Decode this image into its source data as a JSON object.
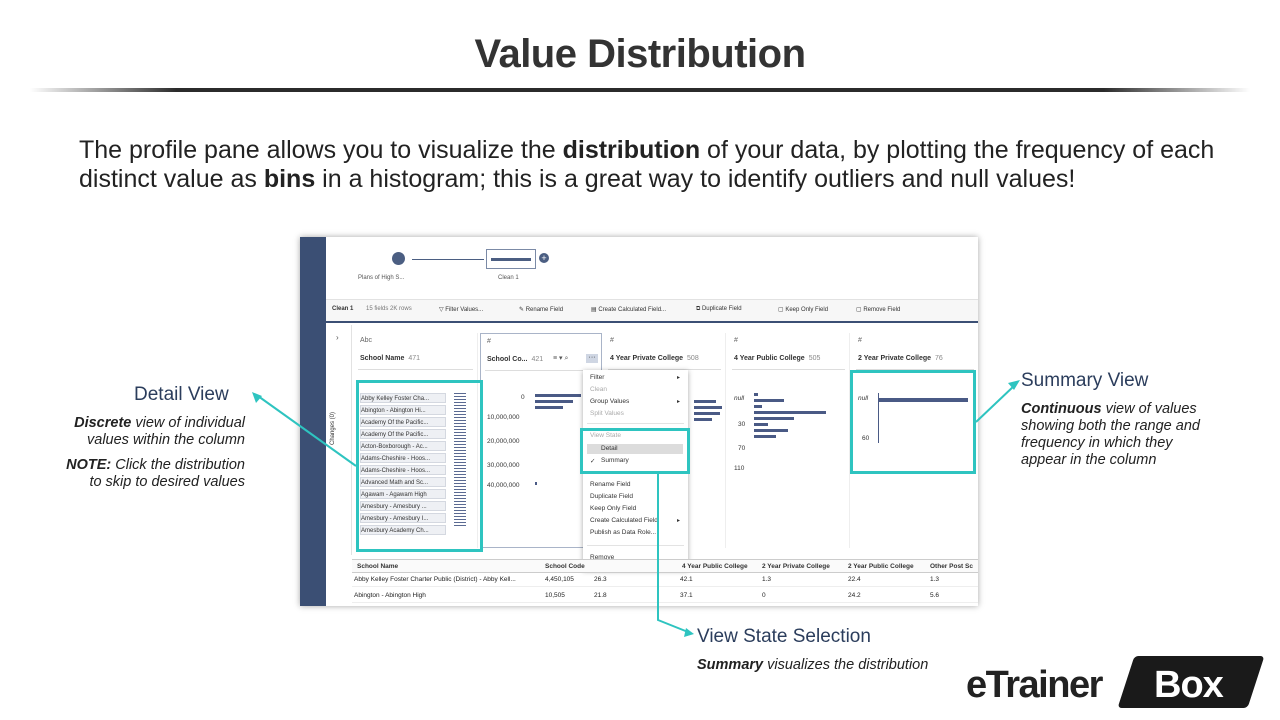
{
  "slide": {
    "title": "Value Distribution",
    "intro": {
      "p1": "The profile pane allows you to visualize the ",
      "b1": "distribution",
      "p2": " of your data, by plotting the frequency of each distinct value as ",
      "b2": "bins",
      "p3": " in a histogram; this is a great way to identify outliers and null values!"
    }
  },
  "flow": {
    "input_label": "Plans of High S...",
    "clean_label": "Clean 1",
    "plus": "+"
  },
  "toolbar": {
    "step": "Clean 1",
    "counts": "15 fields  2K rows",
    "filter": "Filter Values...",
    "rename": "Rename Field",
    "calc": "Create Calculated Field...",
    "duplicate": "Duplicate Field",
    "keep": "Keep Only Field",
    "remove": "Remove Field"
  },
  "changes": {
    "chevron": "›",
    "label": "Changes (0)"
  },
  "columns": [
    {
      "type": "Abc",
      "name": "School Name",
      "count": "471"
    },
    {
      "type": "#",
      "name": "School Co...",
      "count": "421"
    },
    {
      "type": "#",
      "name": "4 Year Private College",
      "count": "508"
    },
    {
      "type": "#",
      "name": "4 Year Public College",
      "count": "505"
    },
    {
      "type": "#",
      "name": "2 Year Private College",
      "count": "76"
    }
  ],
  "school_list": [
    "Abby Kelley Foster Cha...",
    "Abington - Abington Hi...",
    "Academy Of the Pacific...",
    "Academy Of the Pacific...",
    "Acton-Boxborough - Ac...",
    "Adams-Cheshire - Hoos...",
    "Adams-Cheshire - Hoos...",
    "Advanced Math and Sc...",
    "Agawam - Agawam High",
    "Amesbury - Amesbury ...",
    "Amesbury - Amesbury I...",
    "Amesbury Academy Ch..."
  ],
  "col2_axis": [
    "0",
    "10,000,000",
    "20,000,000",
    "30,000,000",
    "40,000,000"
  ],
  "col4_axis": [
    "null",
    "30",
    "70",
    "110"
  ],
  "col5_axis": [
    "null",
    "60"
  ],
  "context_menu": {
    "filter": "Filter",
    "clean": "Clean",
    "group": "Group Values",
    "split": "Split Values",
    "view_state": "View State",
    "detail": "Detail",
    "summary": "Summary",
    "check": "✓",
    "rename": "Rename Field",
    "duplicate": "Duplicate Field",
    "keep": "Keep Only Field",
    "calc": "Create Calculated Field",
    "publish": "Publish as Data Role...",
    "remove": "Remove",
    "arrow": "▸"
  },
  "grid": {
    "headers": [
      "School Name",
      "School Code",
      "4 Year Private College",
      "4 Year Public College",
      "2 Year Private College",
      "2 Year Public College",
      "Other Post Sc"
    ],
    "rows": [
      [
        "Abby Kelley Foster Charter Public (District) - Abby Kell...",
        "4,450,105",
        "26.3",
        "42.1",
        "1.3",
        "22.4",
        "1.3"
      ],
      [
        "Abington - Abington High",
        "10,505",
        "21.8",
        "37.1",
        "0",
        "24.2",
        "5.6"
      ]
    ]
  },
  "callouts": {
    "detail_title": "Detail View",
    "detail_b": "Discrete",
    "detail_t1": " view of individual",
    "detail_t2": "values within the column",
    "note_b": "NOTE:",
    "note_t1": " Click the distribution",
    "note_t2": "to skip to desired values",
    "summary_title": "Summary View",
    "summary_b": "Continuous",
    "summary_t1": " view of values",
    "summary_t2": "showing both the range and",
    "summary_t3": "frequency in which they",
    "summary_t4": "appear in the column",
    "viewstate_title": "View State Selection",
    "viewstate_b": "Summary",
    "viewstate_t": " visualizes the distribution"
  },
  "logo": {
    "left": "eTrainer",
    "right": "Box"
  },
  "colors": {
    "accent": "#2ec4c0",
    "navy": "#3b4f74",
    "bar": "#4a5a85"
  }
}
